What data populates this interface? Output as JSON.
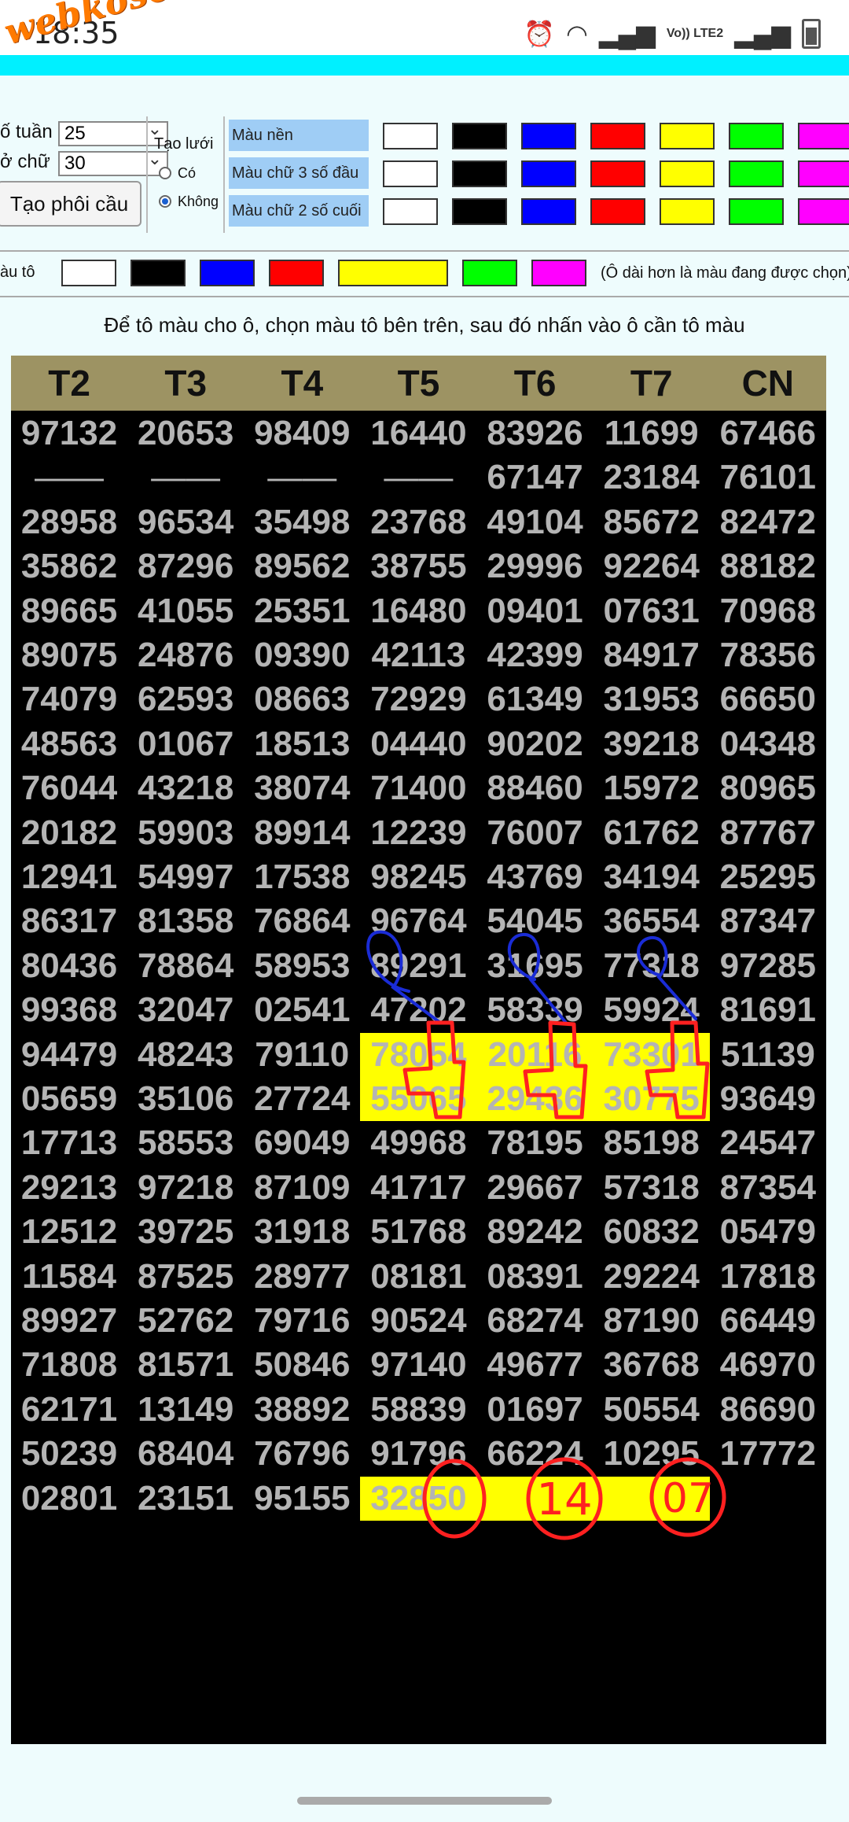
{
  "status_bar": {
    "time": "18:35",
    "network": "Vo)) LTE2"
  },
  "watermark": "webkoso.net",
  "controls": {
    "so_tuan_label": "ố tuần",
    "so_tuan_value": "25",
    "co_chu_label": "ở chữ",
    "co_chu_value": "30",
    "create_button": "Tạo phôi cầu",
    "grid_label": "Tạo lưới",
    "radio_co": "Có",
    "radio_khong": "Không",
    "color_rows": [
      "Màu nền",
      "Màu chữ 3 số đầu",
      "Màu chữ 2 số cuối"
    ],
    "swatch_colors": [
      "#ffffff",
      "#000000",
      "#0000ff",
      "#ff0000",
      "#ffff00",
      "#00ff00",
      "#ff00ff"
    ],
    "mau_to_label": "àu tô",
    "mau_to_note": "(Ô dài hơn là màu đang được chọn)",
    "selected_color": "#ffff00"
  },
  "hint": "Để tô màu cho ô, chọn màu tô bên trên, sau đó nhấn vào ô cần tô màu",
  "table": {
    "headers": [
      "T2",
      "T3",
      "T4",
      "T5",
      "T6",
      "T7",
      "CN"
    ],
    "rows": [
      [
        "97132",
        "20653",
        "98409",
        "16440",
        "83926",
        "11699",
        "67466"
      ],
      [
        "——",
        "——",
        "——",
        "——",
        "67147",
        "23184",
        "76101"
      ],
      [
        "28958",
        "96534",
        "35498",
        "23768",
        "49104",
        "85672",
        "82472"
      ],
      [
        "35862",
        "87296",
        "89562",
        "38755",
        "29996",
        "92264",
        "88182"
      ],
      [
        "89665",
        "41055",
        "25351",
        "16480",
        "09401",
        "07631",
        "70968"
      ],
      [
        "89075",
        "24876",
        "09390",
        "42113",
        "42399",
        "84917",
        "78356"
      ],
      [
        "74079",
        "62593",
        "08663",
        "72929",
        "61349",
        "31953",
        "66650"
      ],
      [
        "48563",
        "01067",
        "18513",
        "04440",
        "90202",
        "39218",
        "04348"
      ],
      [
        "76044",
        "43218",
        "38074",
        "71400",
        "88460",
        "15972",
        "80965"
      ],
      [
        "20182",
        "59903",
        "89914",
        "12239",
        "76007",
        "61762",
        "87767"
      ],
      [
        "12941",
        "54997",
        "17538",
        "98245",
        "43769",
        "34194",
        "25295"
      ],
      [
        "86317",
        "81358",
        "76864",
        "96764",
        "54045",
        "36554",
        "87347"
      ],
      [
        "80436",
        "78864",
        "58953",
        "89291",
        "31695",
        "77318",
        "97285"
      ],
      [
        "99368",
        "32047",
        "02541",
        "47202",
        "58339",
        "59924",
        "81691"
      ],
      [
        "94479",
        "48243",
        "79110",
        "78054",
        "20116",
        "73301",
        "51139"
      ],
      [
        "05659",
        "35106",
        "27724",
        "55065",
        "29436",
        "30775",
        "93649"
      ],
      [
        "17713",
        "58553",
        "69049",
        "49968",
        "78195",
        "85198",
        "24547"
      ],
      [
        "29213",
        "97218",
        "87109",
        "41717",
        "29667",
        "57318",
        "87354"
      ],
      [
        "12512",
        "39725",
        "31918",
        "51768",
        "89242",
        "60832",
        "05479"
      ],
      [
        "11584",
        "87525",
        "28977",
        "08181",
        "08391",
        "29224",
        "17818"
      ],
      [
        "89927",
        "52762",
        "79716",
        "90524",
        "68274",
        "87190",
        "66449"
      ],
      [
        "71808",
        "81571",
        "50846",
        "97140",
        "49677",
        "36768",
        "46970"
      ],
      [
        "62171",
        "13149",
        "38892",
        "58839",
        "01697",
        "50554",
        "86690"
      ],
      [
        "50239",
        "68404",
        "76796",
        "91796",
        "66224",
        "10295",
        "17772"
      ],
      [
        "02801",
        "23151",
        "95155",
        "32850",
        "",
        "",
        ""
      ]
    ]
  },
  "annotations": {
    "handwritten_1": "14",
    "handwritten_2": "07"
  }
}
